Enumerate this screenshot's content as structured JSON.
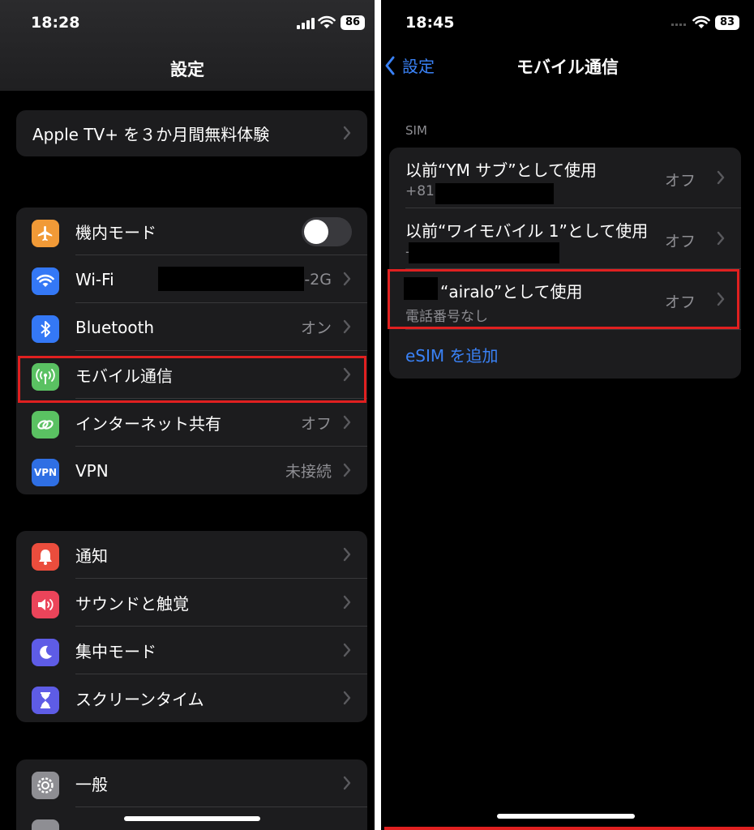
{
  "left": {
    "status": {
      "time": "18:28",
      "battery": "86"
    },
    "nav_title": "設定",
    "promo": {
      "label": "Apple TV+ を３か月間無料体験"
    },
    "group1": [
      {
        "label": "機内モード",
        "icon": "airplane-icon",
        "color": "#f19a37",
        "type": "toggle"
      },
      {
        "label": "Wi-Fi",
        "icon": "wifi-icon",
        "color": "#3478f6",
        "value": "-2G"
      },
      {
        "label": "Bluetooth",
        "icon": "bluetooth-icon",
        "color": "#3478f6",
        "value": "オン"
      },
      {
        "label": "モバイル通信",
        "icon": "antenna-icon",
        "color": "#5ac162"
      },
      {
        "label": "インターネット共有",
        "icon": "link-icon",
        "color": "#5ac162",
        "value": "オフ"
      },
      {
        "label": "VPN",
        "icon": "vpn-icon",
        "icon_text": "VPN",
        "color": "#2f6fe4",
        "value": "未接続"
      }
    ],
    "group2": [
      {
        "label": "通知",
        "icon": "bell-icon",
        "color": "#eb4d3d"
      },
      {
        "label": "サウンドと触覚",
        "icon": "speaker-icon",
        "color": "#eb445a"
      },
      {
        "label": "集中モード",
        "icon": "moon-icon",
        "color": "#5e5ce6"
      },
      {
        "label": "スクリーンタイム",
        "icon": "hourglass-icon",
        "color": "#5e5ce6"
      }
    ],
    "group3": [
      {
        "label": "一般",
        "icon": "gear-icon",
        "color": "#8e8e93"
      }
    ]
  },
  "right": {
    "status": {
      "time": "18:45",
      "battery": "83"
    },
    "back_label": "設定",
    "nav_title": "モバイル通信",
    "section_header": "SIM",
    "sims": [
      {
        "title": "以前“YM サブ”として使用",
        "subtitle": "+81",
        "value": "オフ"
      },
      {
        "title": "以前“ワイモバイル 1”として使用",
        "subtitle": "-",
        "value": "オフ"
      },
      {
        "title": "“airalo”として使用",
        "subtitle": "電話番号なし",
        "value": "オフ"
      }
    ],
    "add_esim": "eSIM を追加"
  },
  "colors": {
    "accent": "#3a82f7",
    "highlight": "#e02020"
  }
}
